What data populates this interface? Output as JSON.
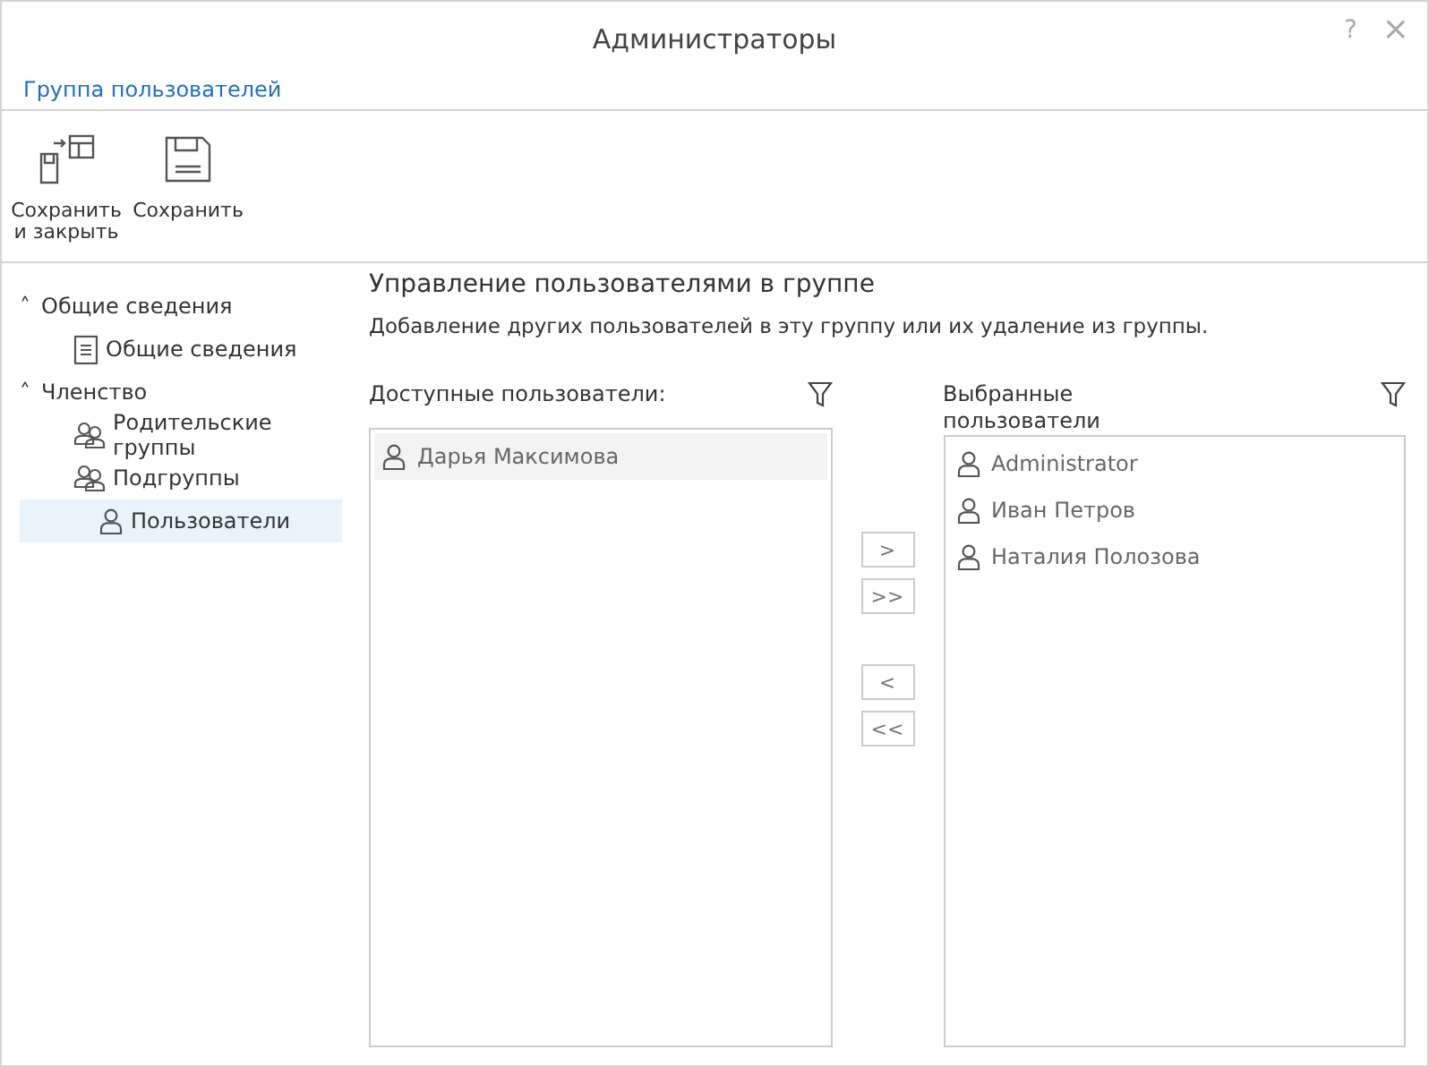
{
  "window": {
    "title": "Администраторы",
    "help": "?",
    "close": "×"
  },
  "header_link": "Группа пользователей",
  "toolbar": [
    {
      "label": "Сохранить и закрыть",
      "kind": "save-close"
    },
    {
      "label": "Сохранить",
      "kind": "save"
    }
  ],
  "sidebar": {
    "items": [
      {
        "label": "Общие сведения",
        "expanded": true,
        "toggle": "˄",
        "children": [
          {
            "label": "Общие сведения",
            "kind": "document",
            "selected": false
          }
        ]
      },
      {
        "label": "Членство",
        "expanded": true,
        "toggle": "˄",
        "children": [
          {
            "label": "Родительские группы",
            "kind": "group",
            "selected": false
          },
          {
            "label": "Подгруппы",
            "kind": "group",
            "selected": false
          },
          {
            "label": "Пользователи",
            "kind": "user",
            "selected": true
          }
        ]
      }
    ]
  },
  "section": {
    "title": "Управление пользователями в группе",
    "description": "Добавление других пользователей в эту группу или их удаление из группы."
  },
  "available": {
    "label": "Доступные пользователи:",
    "items": [
      {
        "name": "Дарья Максимова",
        "selected": true
      }
    ]
  },
  "move_buttons": [
    ">",
    ">>",
    "<",
    "<<"
  ],
  "chosen": {
    "label": "Выбранные пользователи",
    "items": [
      {
        "name": "Administrator",
        "selected": false
      },
      {
        "name": "Иван Петров",
        "selected": false
      },
      {
        "name": "Наталия Полозова",
        "selected": false
      }
    ]
  }
}
